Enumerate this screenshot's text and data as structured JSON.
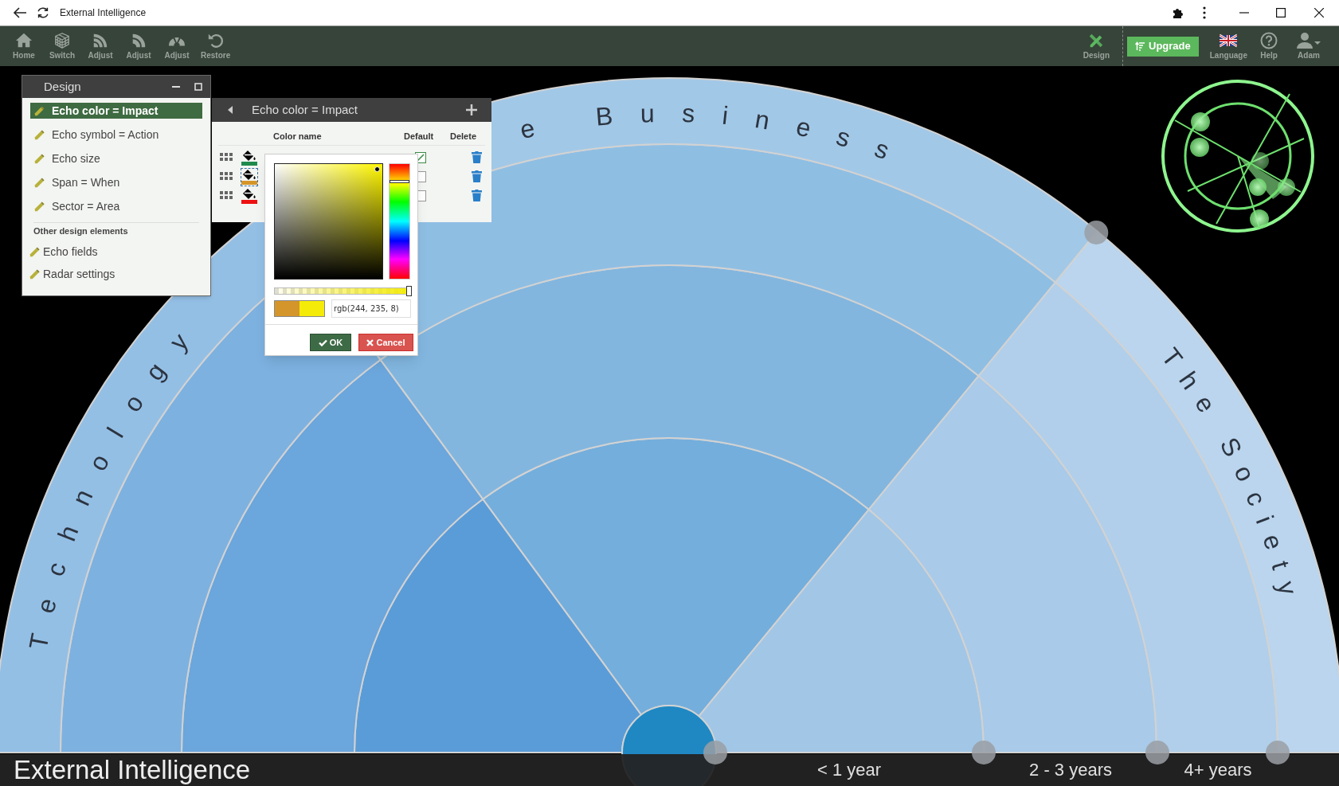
{
  "window": {
    "title": "External Intelligence"
  },
  "toolbar": {
    "left": [
      {
        "label": "Home"
      },
      {
        "label": "Switch"
      },
      {
        "label": "Adjust"
      },
      {
        "label": "Adjust"
      },
      {
        "label": "Adjust"
      },
      {
        "label": "Restore"
      }
    ],
    "design": {
      "label": "Design"
    },
    "upgrade_button": "Upgrade",
    "right": [
      {
        "label": "Language"
      },
      {
        "label": "Help"
      },
      {
        "label": "Adam"
      }
    ]
  },
  "design_panel": {
    "title": "Design",
    "items": [
      {
        "label": "Echo color = Impact",
        "selected": true
      },
      {
        "label": "Echo symbol = Action",
        "selected": false
      },
      {
        "label": "Echo size",
        "selected": false
      },
      {
        "label": "Span = When",
        "selected": false
      },
      {
        "label": "Sector = Area",
        "selected": false
      }
    ],
    "section": "Other design elements",
    "other_items": [
      {
        "label": "Echo fields",
        "selected": false
      },
      {
        "label": "Radar settings",
        "selected": false
      }
    ]
  },
  "echo_color_panel": {
    "title": "Echo color = Impact",
    "columns": [
      "Color name",
      "Default",
      "Delete"
    ],
    "rows": [
      {
        "color": "#1f8a4c",
        "selected": false,
        "default": true
      },
      {
        "color": "#d4962a",
        "selected": true,
        "default": false
      },
      {
        "color": "#ee1111",
        "selected": false,
        "default": false
      }
    ]
  },
  "color_picker": {
    "alpha": {
      "level": 1
    },
    "swatches": [
      {
        "color": "#d4962a"
      },
      {
        "color": "#f4eb08"
      }
    ],
    "value": "rgb(244, 235, 8)",
    "buttons": [
      {
        "label": "OK",
        "kind": "ok"
      },
      {
        "label": "Cancel",
        "kind": "cancel"
      }
    ]
  },
  "radar": {
    "sectors": [
      {
        "label": "Technology",
        "color": "#5a9cd8"
      },
      {
        "label": "e Business",
        "color": "#74aedc"
      },
      {
        "label": "The Society",
        "color": "#a2c6e6"
      }
    ],
    "time_labels": [
      "< 1 year",
      "2 - 3 years",
      "4+ years"
    ]
  },
  "footer": {
    "title": "External Intelligence"
  }
}
